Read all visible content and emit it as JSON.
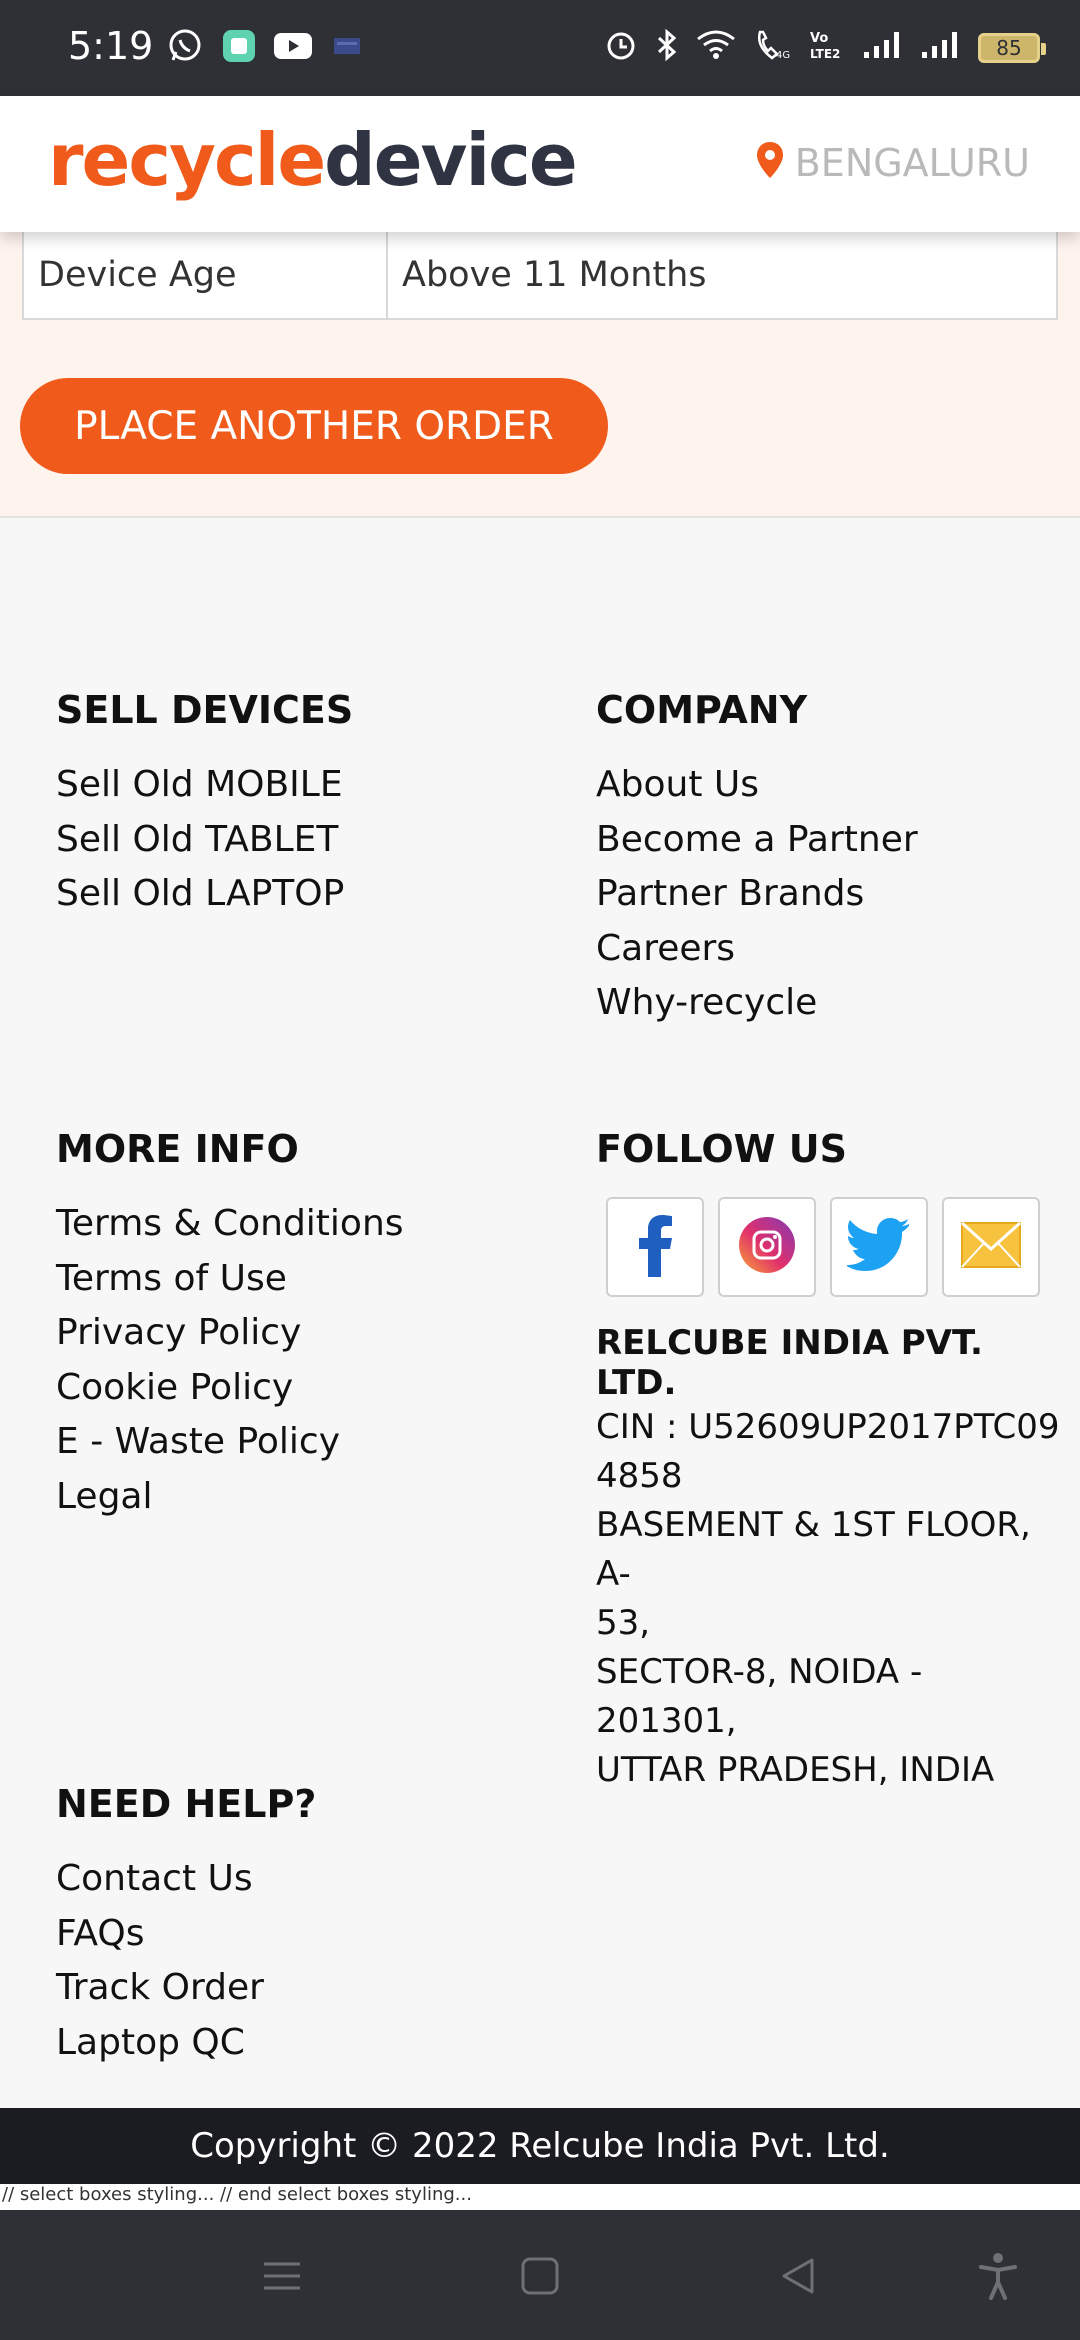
{
  "status_bar": {
    "time": "5:19",
    "battery": "85",
    "left_icons": [
      "whatsapp-icon",
      "app-icon",
      "youtube-icon",
      "mail-icon"
    ],
    "right_icons": [
      "alarm-icon",
      "bluetooth-icon",
      "wifi-icon",
      "wifi-call-icon",
      "volte-icon",
      "signal-1-icon",
      "signal-2-icon"
    ]
  },
  "header": {
    "logo_part1": "recycle",
    "logo_part2": "device",
    "location": "BENGALURU",
    "brand_color": "#f05a1a"
  },
  "order": {
    "detail_label": "Device Age",
    "detail_value": "Above 11 Months",
    "button_label": "PLACE ANOTHER ORDER"
  },
  "footer": {
    "sell_devices": {
      "title": "SELL DEVICES",
      "links": [
        "Sell Old MOBILE",
        "Sell Old TABLET",
        "Sell Old LAPTOP"
      ]
    },
    "company": {
      "title": "COMPANY",
      "links": [
        "About Us",
        "Become a Partner",
        "Partner Brands",
        "Careers",
        "Why-recycle"
      ]
    },
    "more_info": {
      "title": "MORE INFO",
      "links": [
        "Terms & Conditions",
        "Terms of Use",
        "Privacy Policy",
        "Cookie Policy",
        "E - Waste Policy",
        "Legal"
      ]
    },
    "follow_us": {
      "title": "FOLLOW US",
      "social": [
        "facebook-icon",
        "instagram-icon",
        "twitter-icon",
        "email-icon"
      ],
      "company_name": "RELCUBE INDIA PVT. LTD.",
      "address_lines": [
        "CIN : U52609UP2017PTC09",
        "4858",
        "BASEMENT & 1ST FLOOR, A-",
        "53,",
        "SECTOR-8, NOIDA - 201301,",
        "UTTAR PRADESH, INDIA"
      ]
    },
    "need_help": {
      "title": "NEED HELP?",
      "links": [
        "Contact Us",
        "FAQs",
        "Track Order",
        "Laptop QC"
      ]
    },
    "copyright": "Copyright © 2022 Relcube India Pvt. Ltd.",
    "debug_text": "// select boxes styling... // end select boxes styling..."
  },
  "nav_bar": {
    "buttons": [
      "menu-icon",
      "home-icon",
      "back-icon",
      "accessibility-icon"
    ]
  }
}
